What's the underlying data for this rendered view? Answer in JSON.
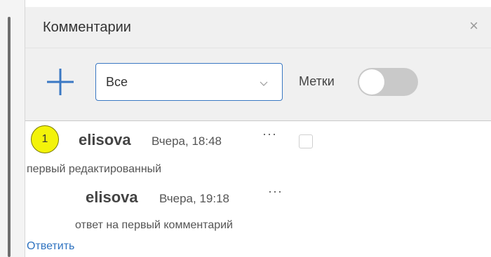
{
  "panel": {
    "title": "Комментарии",
    "close_icon": "×"
  },
  "toolbar": {
    "add_icon": "plus-icon",
    "filter": {
      "selected": "Все",
      "chevron_icon": "chevron-down-icon"
    },
    "tags_label": "Метки",
    "tags_toggle_on": false,
    "accent_color": "#3a78c3"
  },
  "comments": [
    {
      "number": "1",
      "author": "elisova",
      "time": "Вчера, 18:48",
      "menu": "···",
      "text": "первый редактированный",
      "replies": [
        {
          "author": "elisova",
          "time": "Вчера, 19:18",
          "menu": "···",
          "text": "ответ на первый комментарий"
        }
      ],
      "reply_link": "Ответить"
    }
  ]
}
